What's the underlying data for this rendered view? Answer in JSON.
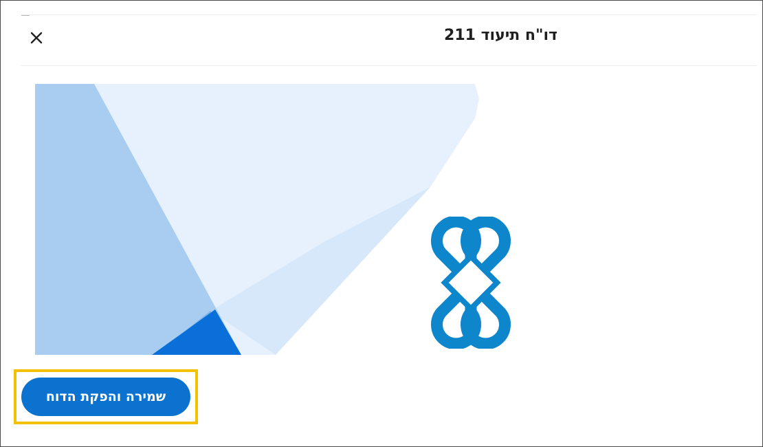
{
  "dialog": {
    "title": "דו\"ח תיעוד 211",
    "close_icon": "close-icon"
  },
  "actions": {
    "save_and_generate_label": "שמירה והפקת הדוח"
  },
  "colors": {
    "primary_button": "#0b72cf",
    "highlight_border": "#f2c200",
    "logo_blue": "#0e86cc",
    "hero_light_blue": "#a9cdf0",
    "hero_pale_blue": "#e6f1fd",
    "hero_dark_blue": "#0a6fd8"
  }
}
